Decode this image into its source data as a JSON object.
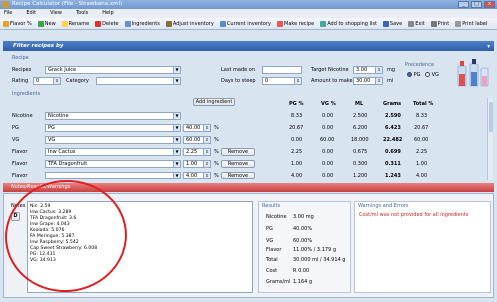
{
  "window": {
    "title": "Recipe Calculator (File - Strawbana.xml)",
    "controls": [
      "_",
      "□",
      "x"
    ]
  },
  "menu": [
    "File",
    "Edit",
    "View",
    "Tools",
    "Help"
  ],
  "toolbar": [
    {
      "label": "Flavor %",
      "icon": "flavor-icon"
    },
    {
      "label": "New",
      "icon": "new-icon"
    },
    {
      "label": "Rename",
      "icon": "rename-icon"
    },
    {
      "label": "Delete",
      "icon": "delete-icon"
    },
    {
      "label": "Ingredients",
      "icon": "ingredients-icon"
    },
    {
      "label": "Adjust inventory",
      "icon": "adjust-icon"
    },
    {
      "label": "Current inventory",
      "icon": "inventory-icon"
    },
    {
      "label": "Make recipe",
      "icon": "make-icon"
    },
    {
      "label": "Add to shopping list",
      "icon": "cart-icon"
    },
    {
      "label": "Save",
      "icon": "save-icon"
    },
    {
      "label": "Exit",
      "icon": "exit-icon"
    },
    {
      "label": "Print",
      "icon": "print-icon"
    },
    {
      "label": "Print label",
      "icon": "label-icon"
    }
  ],
  "filter": {
    "label": "Filter recipes by"
  },
  "recipe": {
    "section": "Recipe",
    "recipes_label": "Recipes",
    "recipes_value": "Grack Juice",
    "rating_label": "Rating",
    "rating_value": "0",
    "category_label": "Category",
    "category_value": "",
    "last_made_label": "Last made on",
    "last_made_value": "",
    "days_label": "Days to steep",
    "days_value": "0",
    "target_nic_label": "Target Nicotine",
    "target_nic_value": "3.00",
    "target_nic_unit": "mg",
    "amount_label": "Amount to make",
    "amount_value": "30.00",
    "amount_unit": "ml",
    "precedence_label": "Precedence",
    "precedence_options": [
      "PG",
      "VG"
    ],
    "precedence_selected": "PG"
  },
  "ingredients": {
    "section": "Ingredients",
    "add_button": "Add ingredient",
    "remove_label": "Remove",
    "columns": [
      "PG %",
      "VG %",
      "ML",
      "Grams",
      "Total %"
    ],
    "rows": [
      {
        "type": "Nicotine",
        "name": "Nicotine",
        "pct": "",
        "pg": "8.33",
        "vg": "0.00",
        "ml": "2.500",
        "grams": "2.590",
        "total": "8.33",
        "remove": false
      },
      {
        "type": "PG",
        "name": "PG",
        "pct": "40.00",
        "pg": "20.67",
        "vg": "0.00",
        "ml": "6.200",
        "grams": "6.423",
        "total": "20.67",
        "remove": false
      },
      {
        "type": "VG",
        "name": "VG",
        "pct": "60.00",
        "pg": "0.00",
        "vg": "60.00",
        "ml": "18.000",
        "grams": "22.482",
        "total": "60.00",
        "remove": false
      },
      {
        "type": "Flavor",
        "name": "Inw Cactus",
        "pct": "2.25",
        "pg": "2.25",
        "vg": "0.00",
        "ml": "0.675",
        "grams": "0.699",
        "total": "2.25",
        "remove": true
      },
      {
        "type": "Flavor",
        "name": "TFA Dragonfruit",
        "pct": "1.00",
        "pg": "1.00",
        "vg": "0.00",
        "ml": "0.300",
        "grams": "0.311",
        "total": "1.00",
        "remove": true
      },
      {
        "type": "Flavor",
        "name": "",
        "pct": "4.00",
        "pg": "4.00",
        "vg": "0.00",
        "ml": "1.200",
        "grams": "1.243",
        "total": "4.00",
        "remove": true
      }
    ]
  },
  "notes_bar": {
    "label": "Notes/Results/Warnings"
  },
  "notes": {
    "label": "Notes",
    "lines": [
      "Nic: 2.59",
      "Inw Cactus: 3.289",
      "TFA Dragonfruit: 3.6",
      "Inw Grape: 4.043",
      "Koolada: 5.076",
      "FA Meringue: 5.387",
      "Inw Raspberry: 5.542",
      "Cap Sweet Strawberry: 6.008",
      "PG: 12.431",
      "VG: 34.913"
    ]
  },
  "results": {
    "label": "Results",
    "rows": [
      {
        "key": "Nicotine",
        "value": "3.00 mg"
      },
      {
        "key": "PG",
        "value": "40.00%"
      },
      {
        "key": "VG",
        "value": "60.00%"
      },
      {
        "key": "Flavor",
        "value": "11.00% / 3.179 g"
      },
      {
        "key": "Total",
        "value": "30.000 ml / 34.914 g"
      },
      {
        "key": "Cost",
        "value": "R 0.00"
      },
      {
        "key": "Grams/ml",
        "value": "1.164 g"
      }
    ]
  },
  "warnings": {
    "label": "Warnings and Errors",
    "text": "Cost/ml was not provided for all ingredients"
  },
  "colors": {
    "accent": "#2f5fa8",
    "notes_bar": "#c94040",
    "annotation": "#e02020",
    "warning_text": "#cc2222"
  }
}
